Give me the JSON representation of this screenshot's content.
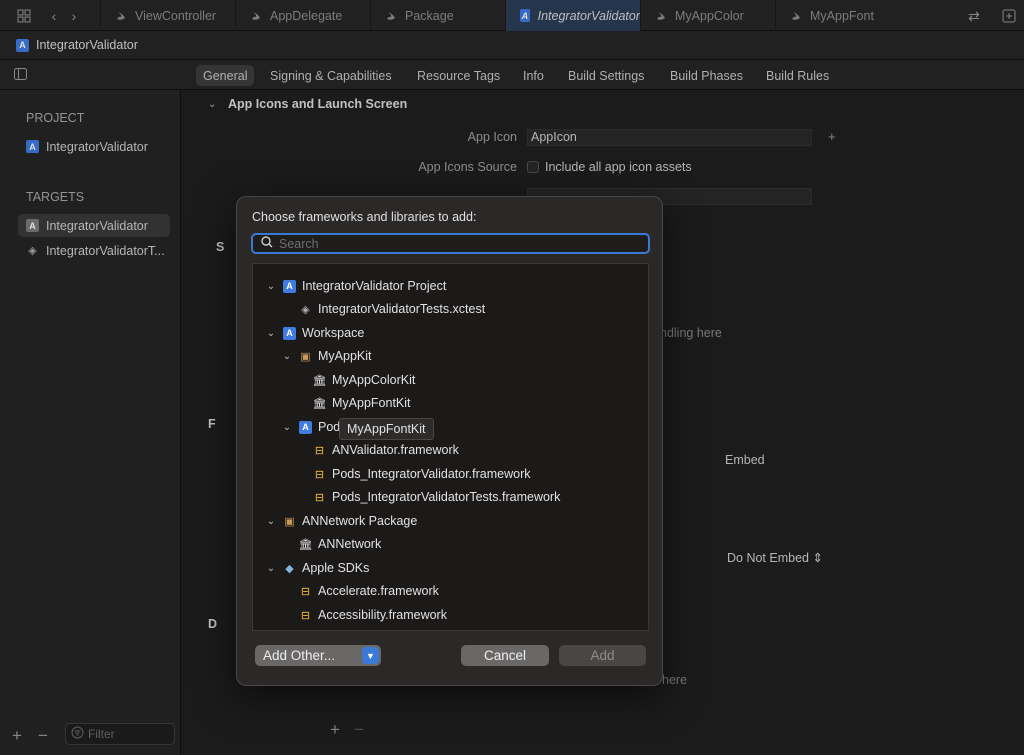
{
  "tabbar": {
    "tabs": [
      {
        "label": "ViewController",
        "icon": "swift-icon"
      },
      {
        "label": "AppDelegate",
        "icon": "swift-icon"
      },
      {
        "label": "Package",
        "icon": "swift-icon"
      },
      {
        "label": "IntegratorValidator",
        "icon": "project-icon"
      },
      {
        "label": "MyAppColor",
        "icon": "swift-icon"
      },
      {
        "label": "MyAppFont",
        "icon": "swift-icon"
      }
    ]
  },
  "breadcrumb": {
    "project": "IntegratorValidator"
  },
  "editor_tabs": [
    "General",
    "Signing & Capabilities",
    "Resource Tags",
    "Info",
    "Build Settings",
    "Build Phases",
    "Build Rules"
  ],
  "sidebar": {
    "project_header": "PROJECT",
    "project_item": "IntegratorValidator",
    "targets_header": "TARGETS",
    "targets": [
      "IntegratorValidator",
      "IntegratorValidatorT..."
    ],
    "filter_placeholder": "Filter"
  },
  "main": {
    "section_app_icons": "App Icons and Launch Screen",
    "app_icon_label": "App Icon",
    "app_icon_value": "AppIcon",
    "app_icons_source_label": "App Icons Source",
    "include_all_label": "Include all app icon assets",
    "partial_text_1": "ndling here",
    "embed_header": "Embed",
    "do_not_embed": "Do Not Embed",
    "partial_text_2": "here",
    "collapsed_sections": [
      "S",
      "F",
      "D"
    ]
  },
  "dialog": {
    "title": "Choose frameworks and libraries to add:",
    "search_placeholder": "Search",
    "tree": [
      {
        "label": "IntegratorValidator Project",
        "level": 0,
        "icon": "project",
        "expanded": true
      },
      {
        "label": "IntegratorValidatorTests.xctest",
        "level": 1,
        "icon": "test"
      },
      {
        "label": "Workspace",
        "level": 0,
        "icon": "project",
        "expanded": true
      },
      {
        "label": "MyAppKit",
        "level": 1,
        "icon": "package",
        "expanded": true
      },
      {
        "label": "MyAppColorKit",
        "level": 2,
        "icon": "library"
      },
      {
        "label": "MyAppFontKit",
        "level": 2,
        "icon": "library"
      },
      {
        "label": "Pods",
        "level": 1,
        "icon": "project",
        "expanded": true
      },
      {
        "label": "ANValidator.framework",
        "level": 2,
        "icon": "framework"
      },
      {
        "label": "Pods_IntegratorValidator.framework",
        "level": 2,
        "icon": "framework"
      },
      {
        "label": "Pods_IntegratorValidatorTests.framework",
        "level": 2,
        "icon": "framework"
      },
      {
        "label": "ANNetwork Package",
        "level": 0,
        "icon": "package",
        "expanded": true
      },
      {
        "label": "ANNetwork",
        "level": 1,
        "icon": "library"
      },
      {
        "label": "Apple SDKs",
        "level": 0,
        "icon": "sdk",
        "expanded": true
      },
      {
        "label": "Accelerate.framework",
        "level": 1,
        "icon": "framework"
      },
      {
        "label": "Accessibility.framework",
        "level": 1,
        "icon": "framework"
      }
    ],
    "tooltip": "MyAppFontKit",
    "add_other_label": "Add Other...",
    "cancel_label": "Cancel",
    "add_label": "Add"
  },
  "colors": {
    "accent": "#3b79d6",
    "tab_active": "#2b3d57",
    "framework_icon": "#f0c340"
  }
}
